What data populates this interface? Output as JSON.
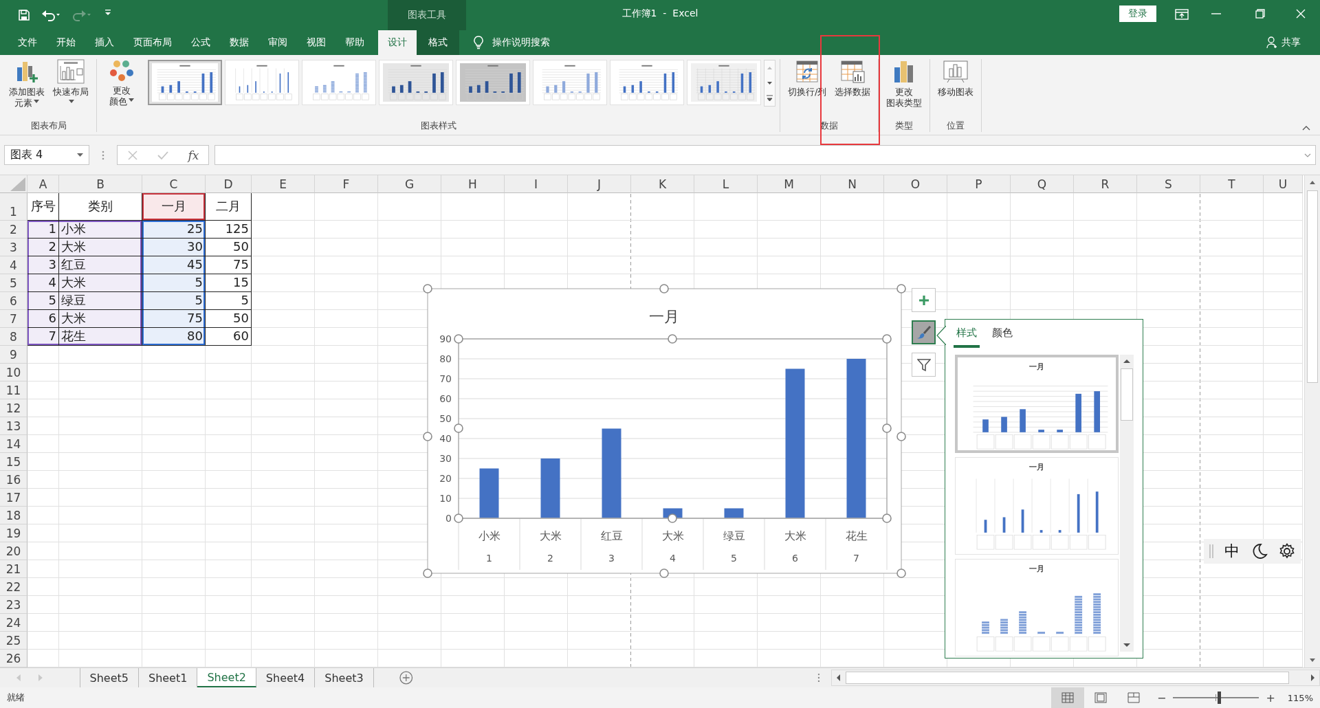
{
  "title_bar": {
    "context_label": "图表工具",
    "title": "工作簿1  -  Excel",
    "login": "登录"
  },
  "menu_tabs": [
    {
      "label": "文件",
      "selected": false,
      "contextual": false
    },
    {
      "label": "开始",
      "selected": false,
      "contextual": false
    },
    {
      "label": "插入",
      "selected": false,
      "contextual": false
    },
    {
      "label": "页面布局",
      "selected": false,
      "contextual": false
    },
    {
      "label": "公式",
      "selected": false,
      "contextual": false
    },
    {
      "label": "数据",
      "selected": false,
      "contextual": false
    },
    {
      "label": "审阅",
      "selected": false,
      "contextual": false
    },
    {
      "label": "视图",
      "selected": false,
      "contextual": false
    },
    {
      "label": "帮助",
      "selected": false,
      "contextual": false
    },
    {
      "label": "设计",
      "selected": true,
      "contextual": true
    },
    {
      "label": "格式",
      "selected": false,
      "contextual": true
    }
  ],
  "tell_me": "操作说明搜索",
  "share": "共享",
  "ribbon": {
    "groups": [
      {
        "label": "图表布局",
        "highlighted": false,
        "buttons": [
          {
            "kind": "add_element",
            "lines": [
              "添加图表",
              "元素"
            ],
            "dropdown": true
          },
          {
            "kind": "quick_layout",
            "lines": [
              "快速布局"
            ],
            "dropdown": true
          }
        ]
      },
      {
        "label": "图表样式",
        "highlighted": false,
        "buttons": [
          {
            "kind": "change_colors",
            "lines": [
              "更改",
              "颜色"
            ],
            "dropdown": true
          }
        ],
        "gallery": [
          {
            "kind": "classic",
            "selected": true
          },
          {
            "kind": "labels",
            "selected": false
          },
          {
            "kind": "striped",
            "selected": false
          },
          {
            "kind": "shaded",
            "selected": false
          },
          {
            "kind": "dark",
            "selected": false
          },
          {
            "kind": "light",
            "selected": false
          },
          {
            "kind": "outline",
            "selected": false
          },
          {
            "kind": "pattern",
            "selected": false
          }
        ]
      },
      {
        "label": "数据",
        "highlighted": true,
        "buttons": [
          {
            "kind": "switch_row_column",
            "lines": [
              "切换行/列"
            ],
            "dropdown": false
          },
          {
            "kind": "select_data",
            "lines": [
              "选择数据"
            ],
            "dropdown": false
          }
        ]
      },
      {
        "label": "类型",
        "highlighted": false,
        "buttons": [
          {
            "kind": "change_type",
            "lines": [
              "更改",
              "图表类型"
            ],
            "dropdown": false
          }
        ]
      },
      {
        "label": "位置",
        "highlighted": false,
        "buttons": [
          {
            "kind": "move_chart",
            "lines": [
              "移动图表"
            ],
            "dropdown": false
          }
        ]
      }
    ]
  },
  "formula_bar": {
    "name_box": "图表 4",
    "function_label": "fx"
  },
  "sheet": {
    "columns": [
      "A",
      "B",
      "C",
      "D",
      "E",
      "F",
      "G",
      "H",
      "I",
      "J",
      "K",
      "L",
      "M",
      "N",
      "O",
      "P",
      "Q",
      "R",
      "S",
      "T",
      "U"
    ],
    "row_numbers": [
      "1",
      "2",
      "3",
      "4",
      "5",
      "6",
      "7",
      "8",
      "9",
      "10",
      "11",
      "12",
      "13",
      "14",
      "15",
      "16",
      "17",
      "18",
      "19",
      "20",
      "21",
      "22",
      "23",
      "24",
      "25",
      "26"
    ],
    "rows": [
      {
        "kind": "header",
        "cells": [
          "序号",
          "类别",
          "一月",
          "二月"
        ]
      },
      {
        "kind": "data",
        "cells": [
          "1",
          "小米",
          "25",
          "125"
        ]
      },
      {
        "kind": "data",
        "cells": [
          "2",
          "大米",
          "30",
          "50"
        ]
      },
      {
        "kind": "data",
        "cells": [
          "3",
          "红豆",
          "45",
          "75"
        ]
      },
      {
        "kind": "data",
        "cells": [
          "4",
          "大米",
          "5",
          "15"
        ]
      },
      {
        "kind": "data",
        "cells": [
          "5",
          "绿豆",
          "5",
          "5"
        ]
      },
      {
        "kind": "data",
        "cells": [
          "6",
          "大米",
          "75",
          "50"
        ]
      },
      {
        "kind": "data",
        "cells": [
          "7",
          "花生",
          "80",
          "60"
        ]
      }
    ],
    "range_highlights": [
      {
        "kind": "categories",
        "color": "#7e57c2"
      },
      {
        "kind": "values",
        "color": "#2f6fd6"
      },
      {
        "kind": "series_name",
        "color": "#c8323c"
      }
    ]
  },
  "chart": {
    "selected": true,
    "category_numbers": [
      "1",
      "2",
      "3",
      "4",
      "5",
      "6",
      "7"
    ],
    "chart_data": {
      "type": "bar",
      "title": "一月",
      "categories": [
        "小米",
        "大米",
        "红豆",
        "大米",
        "绿豆",
        "大米",
        "花生"
      ],
      "series": [
        {
          "color": "#4472c4",
          "values": [
            25,
            30,
            45,
            5,
            5,
            75,
            80
          ]
        }
      ],
      "grid": true,
      "ylim": [
        0,
        90
      ],
      "yticks": [
        0,
        10,
        20,
        30,
        40,
        50,
        60,
        70,
        80,
        90
      ]
    }
  },
  "chart_buttons": [
    {
      "kind": "add",
      "selected": false
    },
    {
      "kind": "style",
      "selected": true
    },
    {
      "kind": "filter",
      "selected": false
    }
  ],
  "style_panel": {
    "tabs": [
      {
        "label": "样式",
        "selected": true
      },
      {
        "label": "颜色",
        "selected": false
      }
    ],
    "previews": [
      {
        "kind": "classic",
        "title": "一月",
        "selected": true
      },
      {
        "kind": "labels",
        "title": "一月",
        "selected": false
      },
      {
        "kind": "striped",
        "title": "一月",
        "selected": false
      }
    ]
  },
  "ime_toolbar": {
    "mode": "中"
  },
  "sheet_tabs": [
    {
      "label": "Sheet5",
      "selected": false
    },
    {
      "label": "Sheet1",
      "selected": false
    },
    {
      "label": "Sheet2",
      "selected": true
    },
    {
      "label": "Sheet4",
      "selected": false
    },
    {
      "label": "Sheet3",
      "selected": false
    }
  ],
  "status_bar": {
    "status": "就绪",
    "views": [
      {
        "kind": "normal",
        "selected": true
      },
      {
        "kind": "page_layout",
        "selected": false
      },
      {
        "kind": "page_break",
        "selected": false
      }
    ],
    "zoom": {
      "minus": "−",
      "plus": "+",
      "level": 0.53,
      "label": "115%"
    }
  }
}
